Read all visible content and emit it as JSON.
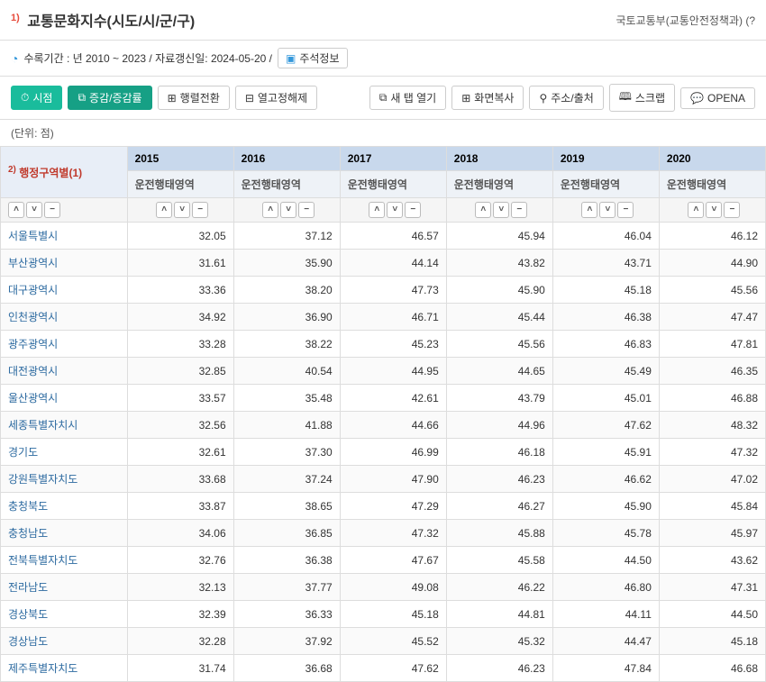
{
  "header": {
    "sup": "1)",
    "title": "교통문화지수(시도/시/군/구)",
    "source": "국토교통부(교통안전정책과) (?"
  },
  "meta": {
    "period_label": "수록기간 : 년 2010 ~ 2023 / 자료갱신일: 2024-05-20 /",
    "annotation_btn": "주석정보"
  },
  "toolbar": {
    "view": "시점",
    "change": "증감/증감률",
    "transpose": "행렬전환",
    "unfix": "열고정해제",
    "newtab": "새 탭 열기",
    "copy": "화면복사",
    "addr": "주소/출처",
    "scrap": "스크랩",
    "openapi": "OPENA"
  },
  "unit": "(단위: 점)",
  "table": {
    "corner": "행정구역별(1)",
    "corner_sup": "2)",
    "years": [
      "2015",
      "2016",
      "2017",
      "2018",
      "2019",
      "2020"
    ],
    "subhead": "운전행태영역",
    "rows": [
      {
        "region": "서울특별시",
        "v": [
          "32.05",
          "37.12",
          "46.57",
          "45.94",
          "46.04",
          "46.12"
        ]
      },
      {
        "region": "부산광역시",
        "v": [
          "31.61",
          "35.90",
          "44.14",
          "43.82",
          "43.71",
          "44.90"
        ]
      },
      {
        "region": "대구광역시",
        "v": [
          "33.36",
          "38.20",
          "47.73",
          "45.90",
          "45.18",
          "45.56"
        ]
      },
      {
        "region": "인천광역시",
        "v": [
          "34.92",
          "36.90",
          "46.71",
          "45.44",
          "46.38",
          "47.47"
        ]
      },
      {
        "region": "광주광역시",
        "v": [
          "33.28",
          "38.22",
          "45.23",
          "45.56",
          "46.83",
          "47.81"
        ]
      },
      {
        "region": "대전광역시",
        "v": [
          "32.85",
          "40.54",
          "44.95",
          "44.65",
          "45.49",
          "46.35"
        ]
      },
      {
        "region": "울산광역시",
        "v": [
          "33.57",
          "35.48",
          "42.61",
          "43.79",
          "45.01",
          "46.88"
        ]
      },
      {
        "region": "세종특별자치시",
        "v": [
          "32.56",
          "41.88",
          "44.66",
          "44.96",
          "47.62",
          "48.32"
        ]
      },
      {
        "region": "경기도",
        "v": [
          "32.61",
          "37.30",
          "46.99",
          "46.18",
          "45.91",
          "47.32"
        ]
      },
      {
        "region": "강원특별자치도",
        "v": [
          "33.68",
          "37.24",
          "47.90",
          "46.23",
          "46.62",
          "47.02"
        ]
      },
      {
        "region": "충청북도",
        "v": [
          "33.87",
          "38.65",
          "47.29",
          "46.27",
          "45.90",
          "45.84"
        ]
      },
      {
        "region": "충청남도",
        "v": [
          "34.06",
          "36.85",
          "47.32",
          "45.88",
          "45.78",
          "45.97"
        ]
      },
      {
        "region": "전북특별자치도",
        "v": [
          "32.76",
          "36.38",
          "47.67",
          "45.58",
          "44.50",
          "43.62"
        ]
      },
      {
        "region": "전라남도",
        "v": [
          "32.13",
          "37.77",
          "49.08",
          "46.22",
          "46.80",
          "47.31"
        ]
      },
      {
        "region": "경상북도",
        "v": [
          "32.39",
          "36.33",
          "45.18",
          "44.81",
          "44.11",
          "44.50"
        ]
      },
      {
        "region": "경상남도",
        "v": [
          "32.28",
          "37.92",
          "45.52",
          "45.32",
          "44.47",
          "45.18"
        ]
      },
      {
        "region": "제주특별자치도",
        "v": [
          "31.74",
          "36.68",
          "47.62",
          "46.23",
          "47.84",
          "46.68"
        ]
      }
    ]
  }
}
